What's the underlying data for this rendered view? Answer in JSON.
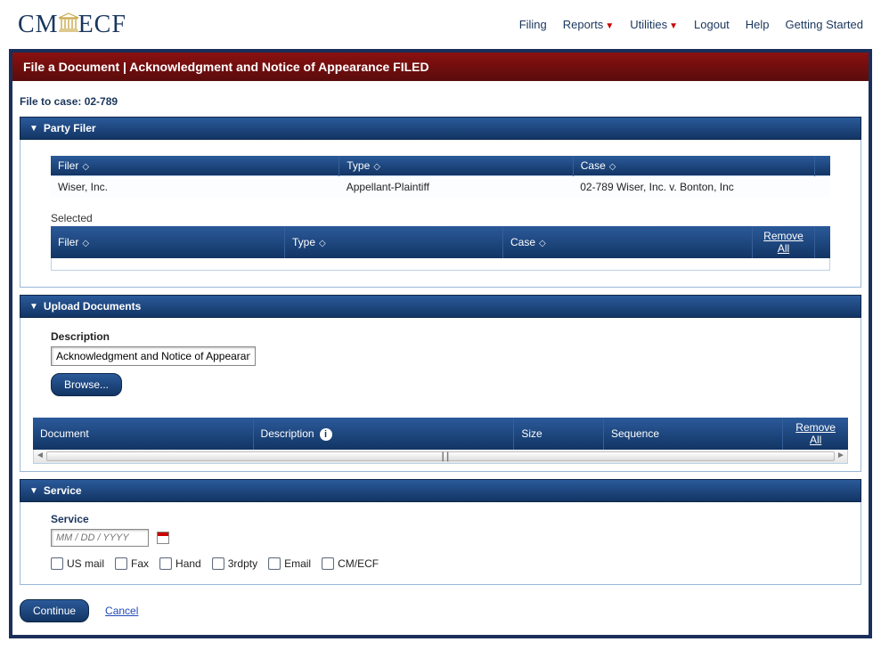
{
  "logo": {
    "left": "CM",
    "right": "ECF"
  },
  "nav": {
    "filing": "Filing",
    "reports": "Reports",
    "utilities": "Utilities",
    "logout": "Logout",
    "help": "Help",
    "getting_started": "Getting Started"
  },
  "red_bar": "File a Document | Acknowledgment and Notice of Appearance FILED",
  "case_line": "File to case: 02-789",
  "party_filer": {
    "title": "Party Filer",
    "headers": {
      "filer": "Filer",
      "type": "Type",
      "case": "Case"
    },
    "row": {
      "filer": "Wiser, Inc.",
      "type": "Appellant-Plaintiff",
      "case": "02-789 Wiser, Inc. v. Bonton, Inc"
    },
    "selected_label": "Selected",
    "selected_headers": {
      "filer": "Filer",
      "type": "Type",
      "case": "Case",
      "remove_all": "Remove All"
    }
  },
  "upload": {
    "title": "Upload Documents",
    "desc_label": "Description",
    "desc_value": "Acknowledgment and Notice of Appearance",
    "browse": "Browse...",
    "doc_headers": {
      "document": "Document",
      "description": "Description",
      "size": "Size",
      "sequence": "Sequence",
      "remove_all": "Remove All"
    }
  },
  "service": {
    "title": "Service",
    "label": "Service",
    "date_placeholder": "MM / DD / YYYY",
    "checks": {
      "us_mail": "US mail",
      "fax": "Fax",
      "hand": "Hand",
      "thirdpty": "3rdpty",
      "email": "Email",
      "cmecf": "CM/ECF"
    }
  },
  "buttons": {
    "continue": "Continue",
    "cancel": "Cancel"
  }
}
